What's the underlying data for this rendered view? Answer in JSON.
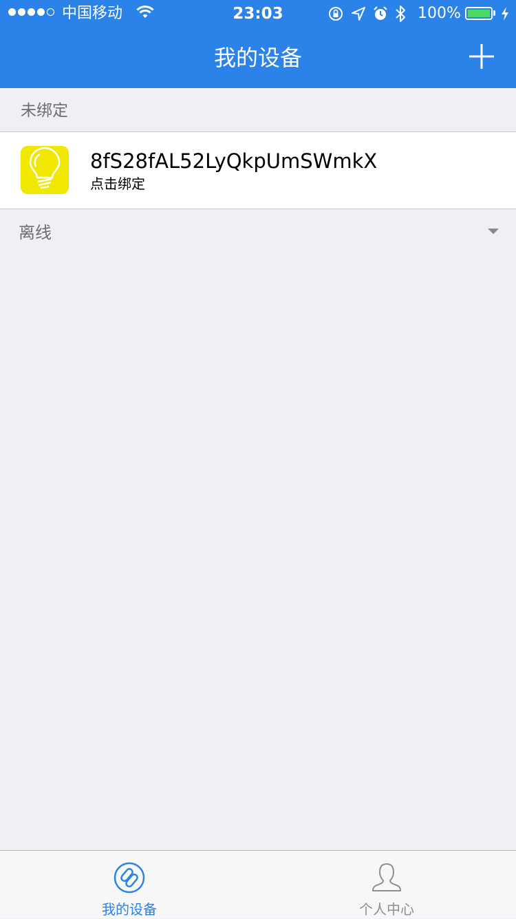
{
  "status_bar": {
    "carrier": "中国移动",
    "time": "23:03",
    "battery_percent": "100%",
    "battery_level": 1.0,
    "battery_color": "#4cd964"
  },
  "nav": {
    "title": "我的设备",
    "add_icon": "plus-icon"
  },
  "sections": {
    "unbound": {
      "label": "未绑定",
      "devices": [
        {
          "name": "8fS28fAL52LyQkpUmSWmkX",
          "subtitle": "点击绑定",
          "icon": "lightbulb-icon",
          "icon_bg": "#f0e800"
        }
      ]
    },
    "offline": {
      "label": "离线",
      "arrow_icon": "triangle-down-icon"
    }
  },
  "tabbar": {
    "tabs": [
      {
        "label": "我的设备",
        "icon": "link-icon",
        "active": true
      },
      {
        "label": "个人中心",
        "icon": "person-icon",
        "active": false
      }
    ]
  },
  "colors": {
    "accent": "#2b82e8",
    "background": "#efeff4",
    "inactive": "#8e8e93"
  }
}
